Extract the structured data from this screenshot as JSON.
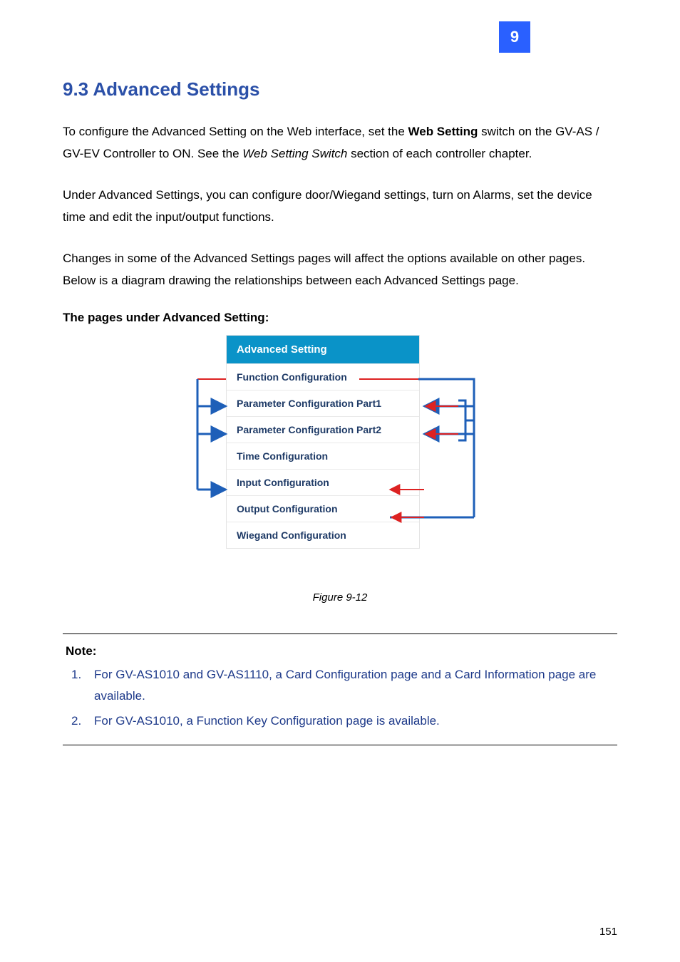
{
  "top_marker": {
    "label": "9"
  },
  "heading": "9.3 Advanced Settings",
  "para1": {
    "t1": "To configure the Advanced Setting on the Web interface, set the ",
    "bold1": "Web Setting",
    "t2": " switch on the GV-AS / GV-EV Controller to ON.  See the ",
    "italic1": "Web Setting Switch",
    "t3": " section of each controller chapter."
  },
  "para2": "Under Advanced Settings, you can configure door/Wiegand settings, turn on Alarms, set the device time and edit the input/output functions.",
  "para3": "Changes in some of the Advanced Settings pages will affect the options available on other pages. Below is a diagram drawing the relationships between each Advanced Settings page.",
  "diagram_label": "The pages under Advanced Setting:",
  "menu": {
    "header": "Advanced Setting",
    "items": [
      "Function Configuration",
      "Parameter Configuration Part1",
      "Parameter Configuration Part2",
      "Time Configuration",
      "Input Configuration",
      "Output Configuration",
      "Wiegand Configuration"
    ]
  },
  "caption": "Figure 9-12",
  "notes": {
    "title": "Note:",
    "items": [
      {
        "num": "1.",
        "text": "For GV-AS1010 and GV-AS1110, a Card Configuration page and a Card Information page are available."
      },
      {
        "num": "2.",
        "text": "For GV-AS1010, a Function Key Configuration page is available."
      }
    ]
  },
  "page_number": "151"
}
